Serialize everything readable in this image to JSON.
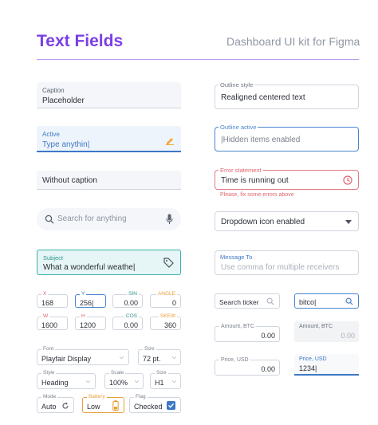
{
  "header": {
    "title": "Text Fields",
    "subtitle": "Dashboard UI kit for Figma"
  },
  "left": {
    "caption_field": {
      "caption": "Caption",
      "value": "Placeholder"
    },
    "active_field": {
      "caption": "Active",
      "value": "Type anythin|"
    },
    "no_caption": {
      "value": "Without caption"
    },
    "search": {
      "placeholder": "Search for anything"
    },
    "subject": {
      "caption": "Subject",
      "value": "What a wonderful weathe|"
    },
    "transform": {
      "x": {
        "label": "X",
        "value": "168"
      },
      "y": {
        "label": "Y",
        "value": "256|"
      },
      "sin": {
        "label": "SIN",
        "value": "0.00"
      },
      "angle": {
        "label": "ANGLE",
        "value": "0"
      },
      "w": {
        "label": "W",
        "value": "1600"
      },
      "h": {
        "label": "H",
        "value": "1200"
      },
      "cos": {
        "label": "COS",
        "value": "0.00"
      },
      "skew": {
        "label": "SKEW",
        "value": "360"
      }
    },
    "font": {
      "label": "Font",
      "value": "Playfair Display"
    },
    "size1": {
      "label": "Size",
      "value": "72 pt."
    },
    "style": {
      "label": "Style",
      "value": "Heading"
    },
    "scale": {
      "label": "Scale",
      "value": "100%"
    },
    "size2": {
      "label": "Size",
      "value": "H1"
    },
    "mode": {
      "label": "Mode",
      "value": "Auto"
    },
    "battery": {
      "label": "Battery",
      "value": "Low"
    },
    "flag": {
      "label": "Flag",
      "value": "Checked"
    }
  },
  "right": {
    "outline_style": {
      "label": "Outline style",
      "value": "Realigned centered text"
    },
    "outline_active": {
      "label": "Outline active",
      "value": "|Hidden items enabled"
    },
    "error": {
      "label": "Error statement",
      "value": "Time is running out",
      "message": "Please, fix some errors above"
    },
    "dropdown": {
      "value": "Dropdown icon enabled"
    },
    "message_to": {
      "label": "Message To",
      "placeholder": "Use comma for multiple receivers"
    },
    "search_ticker": {
      "placeholder": "Search ticker"
    },
    "search_active": {
      "value": "bitco|"
    },
    "amount_btc_1": {
      "label": "Amount, BTC",
      "value": "0.00"
    },
    "amount_btc_2": {
      "label": "Amount, BTC",
      "value": "0.00"
    },
    "price_usd_1": {
      "label": "Price, USD",
      "value": "0.00"
    },
    "price_usd_2": {
      "label": "Price, USD",
      "value": "1234|"
    }
  },
  "colors": {
    "accent": "#7b3fe4",
    "blue": "#3d78c6",
    "error": "#e0646f",
    "teal": "#2e9591",
    "orange": "#e8a03a"
  }
}
